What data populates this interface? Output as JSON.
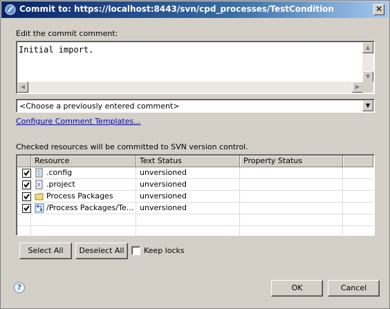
{
  "window": {
    "title": "Commit to: https://localhost:8443/svn/cpd_processes/TestCondition",
    "close_symbol": "✕"
  },
  "comment": {
    "label": "Edit the commit comment:",
    "value": "Initial import."
  },
  "previous_comments": {
    "selected": "<Choose a previously entered comment>"
  },
  "configure_link": "Configure Comment Templates...",
  "resources": {
    "label": "Checked resources will be committed to SVN version control.",
    "columns": [
      "Resource",
      "Text Status",
      "Property Status"
    ],
    "rows": [
      {
        "name": ".config",
        "text_status": "unversioned",
        "property_status": "",
        "checked": true,
        "icon": "config-file-icon"
      },
      {
        "name": ".project",
        "text_status": "unversioned",
        "property_status": "",
        "checked": true,
        "icon": "xml-file-icon"
      },
      {
        "name": "Process Packages",
        "text_status": "unversioned",
        "property_status": "",
        "checked": true,
        "icon": "folder-icon"
      },
      {
        "name": "/Process Packages/Te...",
        "text_status": "unversioned",
        "property_status": "",
        "checked": true,
        "icon": "process-file-icon"
      }
    ]
  },
  "buttons": {
    "select_all": "Select All",
    "deselect_all": "Deselect All",
    "keep_locks": "Keep locks",
    "ok": "OK",
    "cancel": "Cancel",
    "help": "?"
  }
}
